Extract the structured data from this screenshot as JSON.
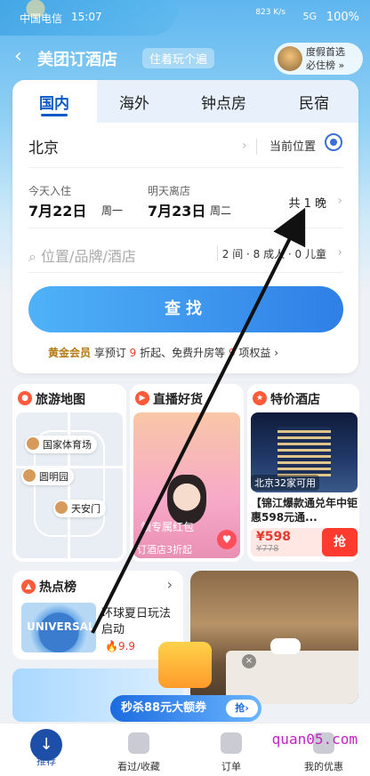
{
  "status": {
    "carrier": "中国电信",
    "time": "15:07",
    "speed": "823 K/s",
    "net": "5G",
    "battery": "100%"
  },
  "nav": {
    "title": "美团订酒店",
    "slogan": "住着玩个遍",
    "promo_line1": "度假首选",
    "promo_line2": "必住榜 »"
  },
  "tabs": [
    "国内",
    "海外",
    "钟点房",
    "民宿"
  ],
  "search": {
    "city": "北京",
    "current_location": "当前位置",
    "checkin_label": "今天入住",
    "checkin_date": "7月22日",
    "checkin_weekday": "周一",
    "checkout_label": "明天离店",
    "checkout_date": "7月23日",
    "checkout_weekday": "周二",
    "nights": "共 1 晚",
    "keyword_placeholder": "位置/品牌/酒店",
    "guests": "2 间 · 8 成人 · 0 儿童",
    "find_button": "查找"
  },
  "member": {
    "level": "黄金会员",
    "text1": "享预订 ",
    "n1": "9",
    "text2": " 折起、免费升房等 ",
    "n2": "9",
    "text3": " 项权益"
  },
  "tiles": {
    "map": {
      "title": "旅游地图",
      "pin1": "国家体育场",
      "pin2": "圆明园",
      "pin3": "天安门"
    },
    "live": {
      "title": "直播好货",
      "caption1": "领专属红包",
      "caption2": "订酒店3折起"
    },
    "deal": {
      "title": "特价酒店",
      "city_tag": "北京32家可用",
      "desc": "【锦江爆款通兑年中钜惠598元通...",
      "price": "¥598",
      "old_price": "¥778",
      "grab": "抢"
    }
  },
  "hotlist": {
    "title": "热点榜",
    "item_text": "环球夏日玩法启动",
    "score": "9.9",
    "img_label": "UNIVERSAL"
  },
  "flash": {
    "text": "秒杀88元大额券",
    "grab": "抢"
  },
  "bottom_nav": [
    {
      "label": "推荐"
    },
    {
      "label": "看过/收藏"
    },
    {
      "label": "订单"
    },
    {
      "label": "我的优惠"
    }
  ],
  "watermark": "quan05.com",
  "colors": {
    "accent": "#0a5ac8",
    "button": "#2f7fe6",
    "price": "#e53b30"
  }
}
